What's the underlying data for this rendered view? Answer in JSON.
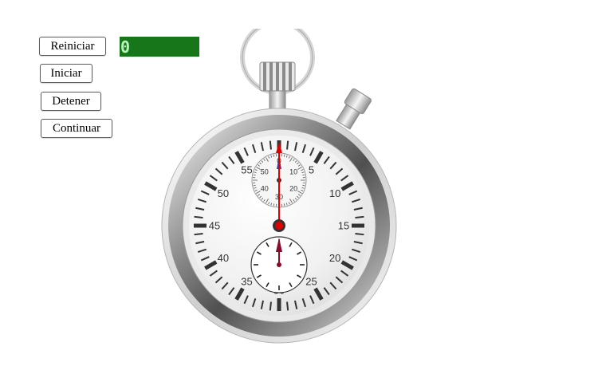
{
  "controls": {
    "reset_label": "Reiniciar",
    "start_label": "Iniciar",
    "stop_label": "Detener",
    "continue_label": "Continuar"
  },
  "display": {
    "counter_value": "0"
  },
  "stopwatch": {
    "main_dial_labels": [
      "5",
      "10",
      "15",
      "20",
      "25",
      "30",
      "35",
      "40",
      "45",
      "50",
      "55"
    ],
    "minute_dial_labels": [
      "10",
      "20",
      "30",
      "40",
      "50"
    ],
    "minute_dial_top_label": "0",
    "seconds_hand_value": 0,
    "minute_hand_value": 0,
    "small_hand_value": 0,
    "accent_hand_color": "#e00000",
    "counter_bg_color": "#17761a"
  }
}
